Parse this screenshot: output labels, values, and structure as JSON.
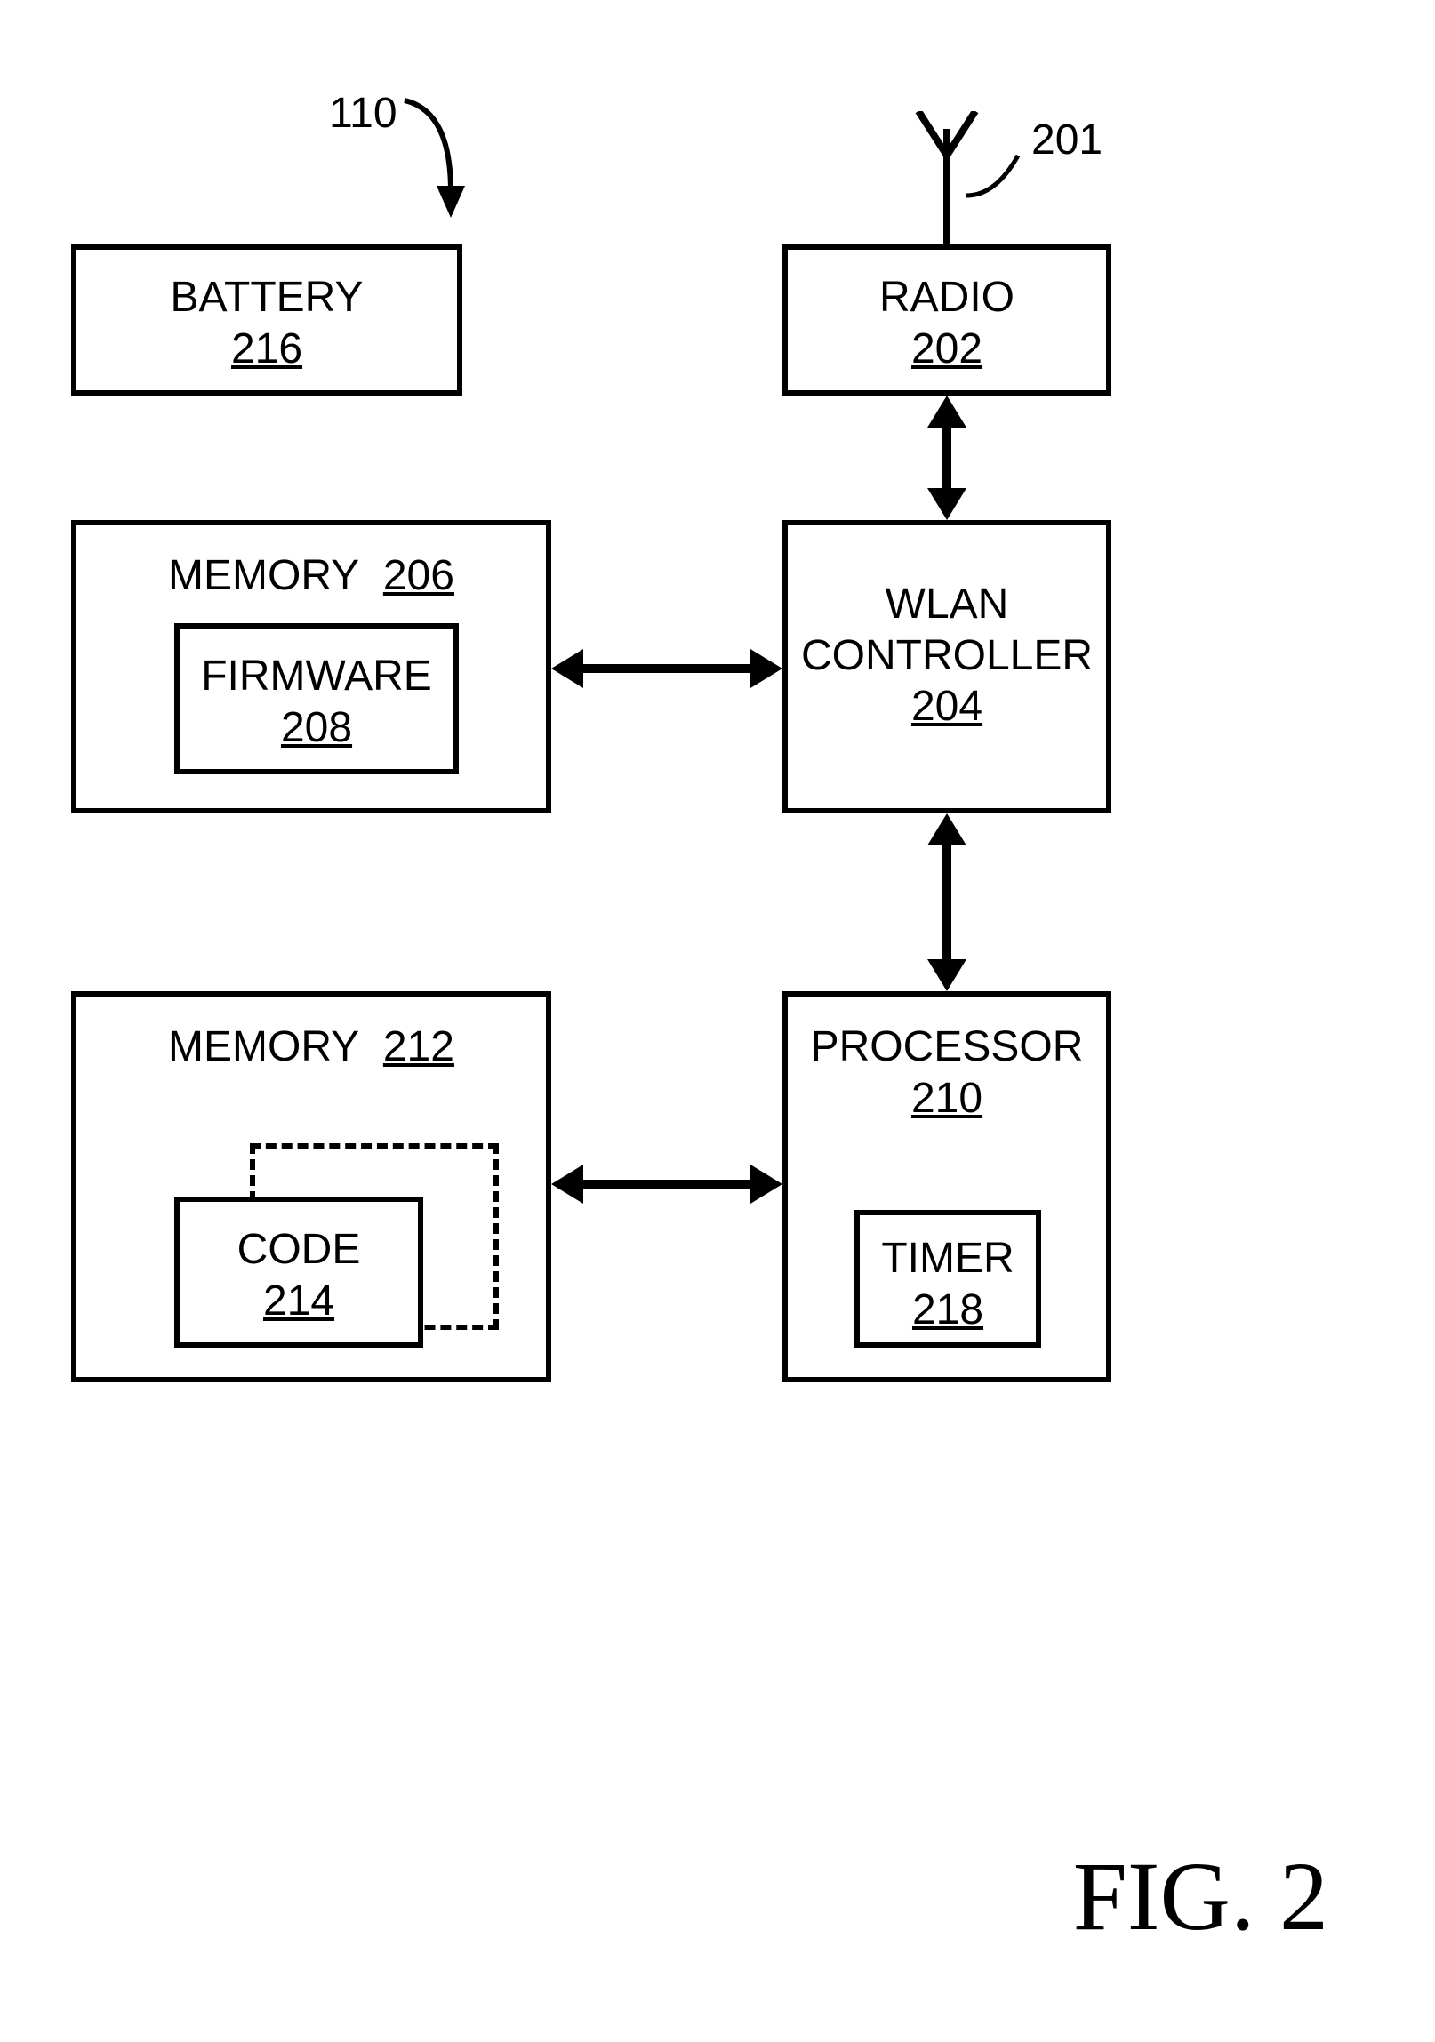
{
  "figure_label": "FIG. 2",
  "callout_110": "110",
  "callout_201": "201",
  "battery": {
    "title": "BATTERY",
    "ref": "216"
  },
  "radio": {
    "title": "RADIO",
    "ref": "202"
  },
  "memory206": {
    "title": "MEMORY",
    "ref": "206"
  },
  "firmware": {
    "title": "FIRMWARE",
    "ref": "208"
  },
  "wlan": {
    "title_l1": "WLAN",
    "title_l2": "CONTROLLER",
    "ref": "204"
  },
  "memory212": {
    "title": "MEMORY",
    "ref": "212"
  },
  "code": {
    "title": "CODE",
    "ref": "214"
  },
  "processor": {
    "title": "PROCESSOR",
    "ref": "210"
  },
  "timer": {
    "title": "TIMER",
    "ref": "218"
  }
}
